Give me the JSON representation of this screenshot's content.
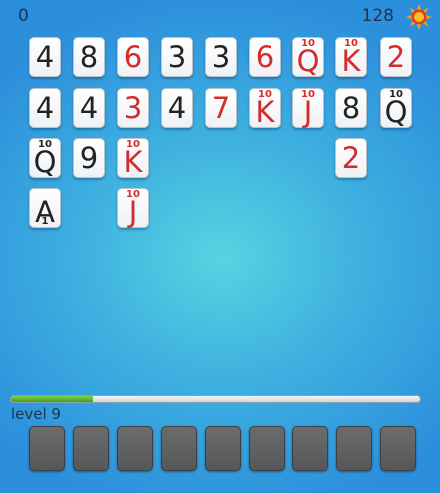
{
  "header": {
    "score": "0",
    "coins": "128",
    "coin_icon": "sun-icon"
  },
  "board": {
    "cards": [
      {
        "rank": "4",
        "color": "black",
        "row": 0,
        "col": 0
      },
      {
        "rank": "8",
        "color": "black",
        "row": 0,
        "col": 1
      },
      {
        "rank": "6",
        "color": "red",
        "row": 0,
        "col": 2
      },
      {
        "rank": "3",
        "color": "black",
        "row": 0,
        "col": 3
      },
      {
        "rank": "3",
        "color": "black",
        "row": 0,
        "col": 4
      },
      {
        "rank": "6",
        "color": "red",
        "row": 0,
        "col": 5
      },
      {
        "rank": "Q",
        "color": "red",
        "row": 0,
        "col": 6,
        "badge": "10"
      },
      {
        "rank": "K",
        "color": "red",
        "row": 0,
        "col": 7,
        "badge": "10"
      },
      {
        "rank": "2",
        "color": "red",
        "row": 0,
        "col": 8
      },
      {
        "rank": "4",
        "color": "black",
        "row": 1,
        "col": 0
      },
      {
        "rank": "4",
        "color": "black",
        "row": 1,
        "col": 1
      },
      {
        "rank": "3",
        "color": "red",
        "row": 1,
        "col": 2
      },
      {
        "rank": "4",
        "color": "black",
        "row": 1,
        "col": 3
      },
      {
        "rank": "7",
        "color": "red",
        "row": 1,
        "col": 4
      },
      {
        "rank": "K",
        "color": "red",
        "row": 1,
        "col": 5,
        "badge": "10"
      },
      {
        "rank": "J",
        "color": "red",
        "row": 1,
        "col": 6,
        "badge": "10"
      },
      {
        "rank": "8",
        "color": "black",
        "row": 1,
        "col": 7
      },
      {
        "rank": "Q",
        "color": "black",
        "row": 1,
        "col": 8,
        "badge": "10"
      },
      {
        "rank": "Q",
        "color": "black",
        "row": 2,
        "col": 0,
        "badge": "10"
      },
      {
        "rank": "9",
        "color": "black",
        "row": 2,
        "col": 1
      },
      {
        "rank": "K",
        "color": "red",
        "row": 2,
        "col": 2,
        "badge": "10"
      },
      {
        "rank": "2",
        "color": "red",
        "row": 2,
        "col": 7
      },
      {
        "rank": "A",
        "color": "black",
        "row": 3,
        "col": 0,
        "badge_bottom": "1"
      },
      {
        "rank": "J",
        "color": "red",
        "row": 3,
        "col": 2,
        "badge": "10"
      }
    ]
  },
  "progress": {
    "fraction": 0.2
  },
  "level": {
    "label": "level 9"
  },
  "tray": {
    "slot_count": 9
  },
  "colors": {
    "red": "#d42b2b",
    "black": "#222222",
    "progress": "#4fb52c"
  }
}
